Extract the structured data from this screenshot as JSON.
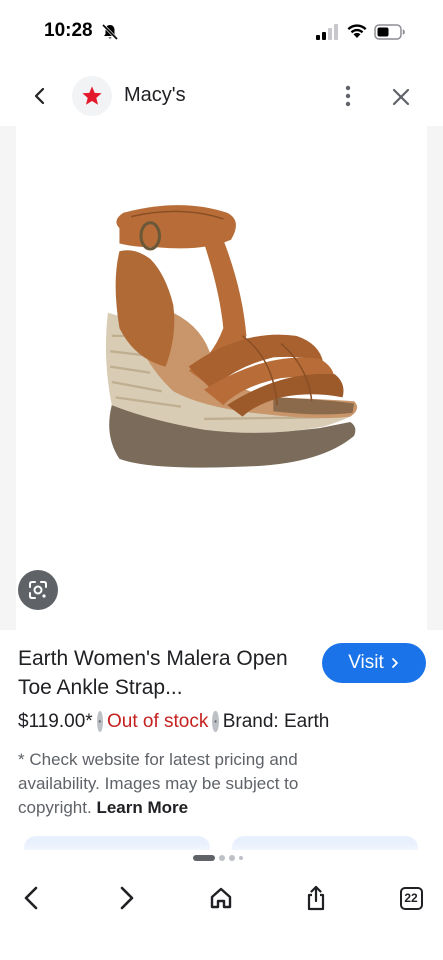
{
  "status_bar": {
    "time": "10:28",
    "icons": [
      "bell-slash-icon",
      "signal-icon",
      "wifi-icon",
      "battery-icon"
    ]
  },
  "app_bar": {
    "site_name": "Macy's",
    "logo_icon": "macys-star-logo",
    "back_icon": "chevron-left-icon",
    "more_icon": "more-vertical-icon",
    "close_icon": "close-icon",
    "brand_color": "#e21a2c"
  },
  "product": {
    "title": "Earth Women's Malera Open Toe Ankle Strap...",
    "visit_label": "Visit",
    "price": "$119.00*",
    "stock_status": "Out of stock",
    "brand": "Brand: Earth",
    "disclaimer": "* Check website for latest pricing and availability. Images may be subject to copyright.",
    "learn_more": "Learn More",
    "image_description_icon": "sandal-image",
    "lens_icon": "lens-icon"
  },
  "carousel": {
    "active_page": 1,
    "total_pages": 4
  },
  "toolbar": {
    "back_icon": "chevron-left-icon",
    "forward_icon": "chevron-right-icon",
    "home_icon": "home-icon",
    "share_icon": "share-icon",
    "tab_count": "22"
  },
  "colors": {
    "accent": "#1a73e8",
    "out_of_stock": "#c5221f",
    "text": "#202124",
    "secondary_text": "#5f6368"
  }
}
